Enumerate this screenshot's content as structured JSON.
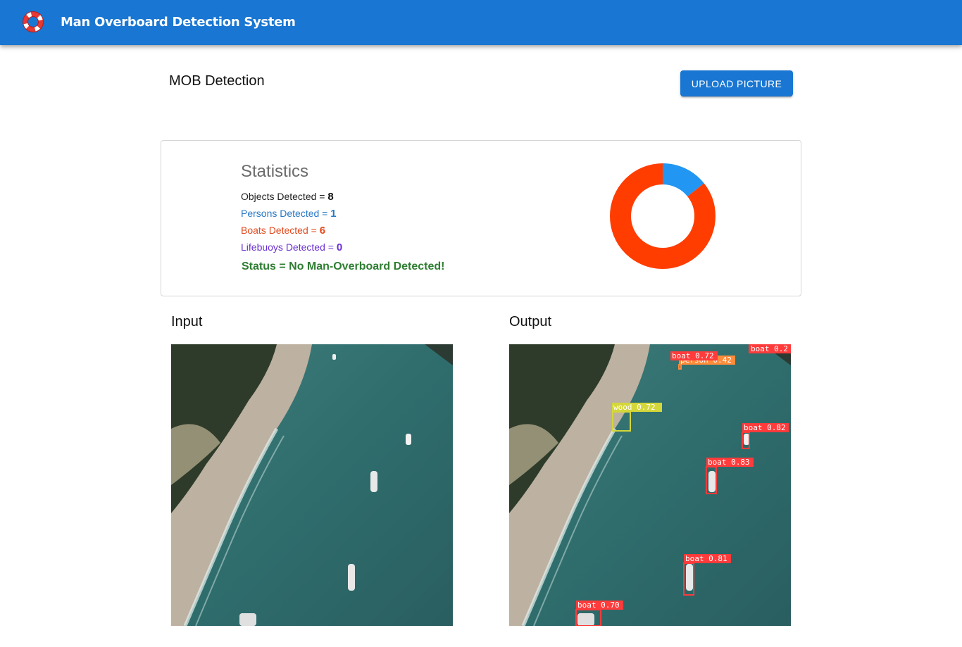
{
  "app": {
    "title": "Man Overboard Detection System",
    "logo_icon": "lifebuoy-icon"
  },
  "page": {
    "title": "MOB Detection",
    "upload_button": "UPLOAD PICTURE"
  },
  "statistics": {
    "title": "Statistics",
    "objects_label": "Objects Detected = ",
    "objects_value": "8",
    "persons_label": "Persons Detected = ",
    "persons_value": "1",
    "boats_label": "Boats Detected = ",
    "boats_value": "6",
    "lifebuoys_label": "Lifebuoys Detected = ",
    "lifebuoys_value": "0",
    "status": "Status = No Man-Overboard Detected!",
    "colors": {
      "persons": "#2196f3",
      "boats": "#ff3d00",
      "lifebuoys": "#6a2fd1",
      "status": "#2e7d32"
    }
  },
  "chart_data": {
    "type": "pie",
    "categories": [
      "Persons",
      "Boats",
      "Lifebuoys"
    ],
    "values": [
      1,
      6,
      0
    ],
    "colors": [
      "#2196f3",
      "#ff3d00",
      "#6a2fd1"
    ],
    "title": ""
  },
  "sections": {
    "input_label": "Input",
    "output_label": "Output"
  },
  "detections": [
    {
      "label": "boat 0.72"
    },
    {
      "label": "person 0.42"
    },
    {
      "label": "boat 0.2"
    },
    {
      "label": "wood 0.72"
    },
    {
      "label": "boat 0.82"
    },
    {
      "label": "boat 0.83"
    },
    {
      "label": "boat 0.81"
    },
    {
      "label": "boat 0.70"
    }
  ]
}
